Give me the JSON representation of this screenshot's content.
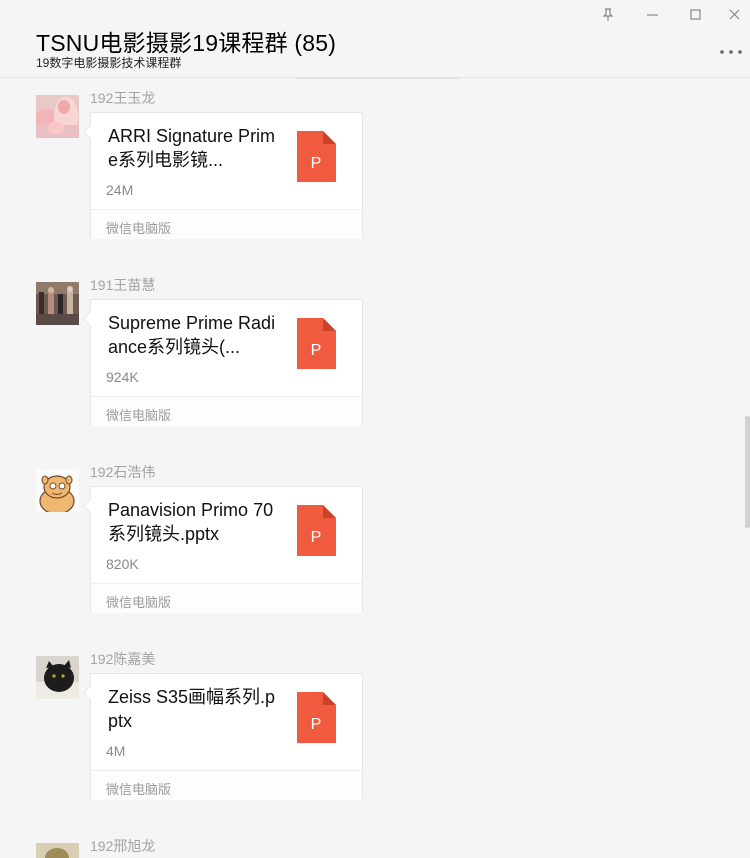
{
  "header": {
    "title": "TSNU电影摄影19课程群 (85)",
    "subtitle": "19数字电影摄影技术课程群"
  },
  "window_controls": {
    "pin": "pin-icon",
    "minimize": "minimize-icon",
    "maximize": "maximize-icon",
    "close": "close-icon",
    "more": "more-icon"
  },
  "messages": [
    {
      "sender": "192王玉龙",
      "file_name": "ARRI Signature Prime系列电影镜...",
      "file_size": "24M",
      "file_icon_letter": "P",
      "source": "微信电脑版"
    },
    {
      "sender": "191王苗慧",
      "file_name": "Supreme Prime Radiance系列镜头(...",
      "file_size": "924K",
      "file_icon_letter": "P",
      "source": "微信电脑版"
    },
    {
      "sender": "192石浩伟",
      "file_name": "Panavision Primo 70系列镜头.pptx",
      "file_size": "820K",
      "file_icon_letter": "P",
      "source": "微信电脑版"
    },
    {
      "sender": "192陈嘉美",
      "file_name": "Zeiss S35画幅系列.pptx",
      "file_size": "4M",
      "file_icon_letter": "P",
      "source": "微信电脑版"
    },
    {
      "sender": "192邢旭龙"
    }
  ],
  "colors": {
    "ppt_icon": "#f05b3f",
    "ppt_icon_fold": "#c9432b",
    "background": "#f5f5f5"
  }
}
